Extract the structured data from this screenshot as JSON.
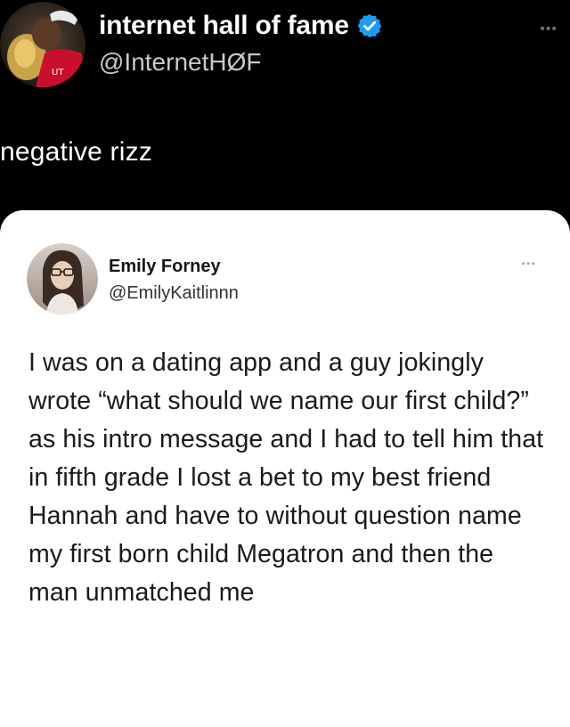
{
  "outer_tweet": {
    "display_name": "internet hall of fame",
    "handle": "@InternetHØF",
    "more_label": "•••",
    "text": "negative rizz",
    "avatar_icon": "user-avatar-photo",
    "verified_icon": "verified-badge-icon",
    "verified_color": "#1d9bf0"
  },
  "quoted_tweet": {
    "display_name": "Emily Forney",
    "handle": "@EmilyKaitlinnn",
    "more_label": "•••",
    "avatar_icon": "user-avatar-photo",
    "text": "I was on a dating app and a guy jokingly wrote “what should we name our first child?” as his intro message and I had to tell him that in fifth grade I lost a bet to my best friend Hannah and have to without question name my first born child Megatron and then the man unmatched me"
  },
  "colors": {
    "background": "#000000",
    "card_background": "#ffffff",
    "accent": "#1d9bf0"
  }
}
